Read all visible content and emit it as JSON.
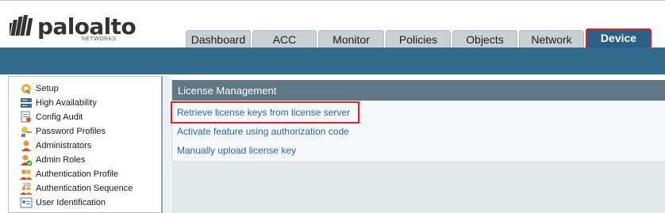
{
  "brand": {
    "name": "paloalto",
    "sub": "NETWORKS"
  },
  "tabs": [
    {
      "label": "Dashboard"
    },
    {
      "label": "ACC"
    },
    {
      "label": "Monitor"
    },
    {
      "label": "Policies"
    },
    {
      "label": "Objects"
    },
    {
      "label": "Network"
    },
    {
      "label": "Device",
      "active": true
    }
  ],
  "sidebar": {
    "items": [
      {
        "label": "Setup",
        "icon": "setup-icon"
      },
      {
        "label": "High Availability",
        "icon": "high-availability-icon"
      },
      {
        "label": "Config Audit",
        "icon": "config-audit-icon"
      },
      {
        "label": "Password Profiles",
        "icon": "password-profiles-icon"
      },
      {
        "label": "Administrators",
        "icon": "administrators-icon"
      },
      {
        "label": "Admin Roles",
        "icon": "admin-roles-icon"
      },
      {
        "label": "Authentication Profile",
        "icon": "authentication-profile-icon"
      },
      {
        "label": "Authentication Sequence",
        "icon": "authentication-sequence-icon"
      },
      {
        "label": "User Identification",
        "icon": "user-identification-icon"
      }
    ]
  },
  "panel": {
    "title": "License Management",
    "links": [
      {
        "label": "Retrieve license keys from license server",
        "highlighted": true
      },
      {
        "label": "Activate feature using authorization code"
      },
      {
        "label": "Manually upload license key"
      }
    ]
  },
  "colors": {
    "highlight": "#e0202a",
    "band": "#336b8c",
    "panel_header": "#5f7887",
    "link": "#2e63a0"
  }
}
